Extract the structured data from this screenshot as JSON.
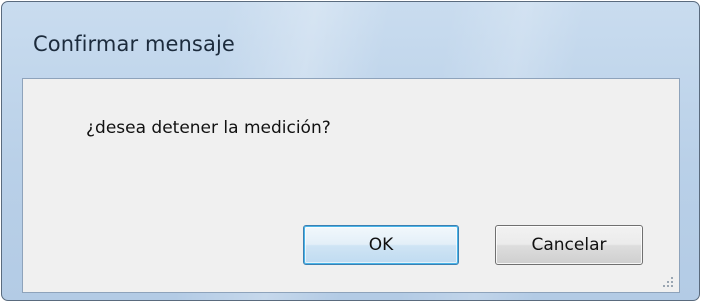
{
  "dialog": {
    "title": "Confirmar mensaje",
    "message": "¿desea detener la medición?",
    "ok_label": "OK",
    "cancel_label": "Cancelar"
  },
  "icons": {
    "resize_grip": "resize-grip-icon"
  },
  "colors": {
    "title_bar": "#bcd2ea",
    "client_background": "#f0f0f0",
    "default_button_border": "#3c7fb1"
  }
}
